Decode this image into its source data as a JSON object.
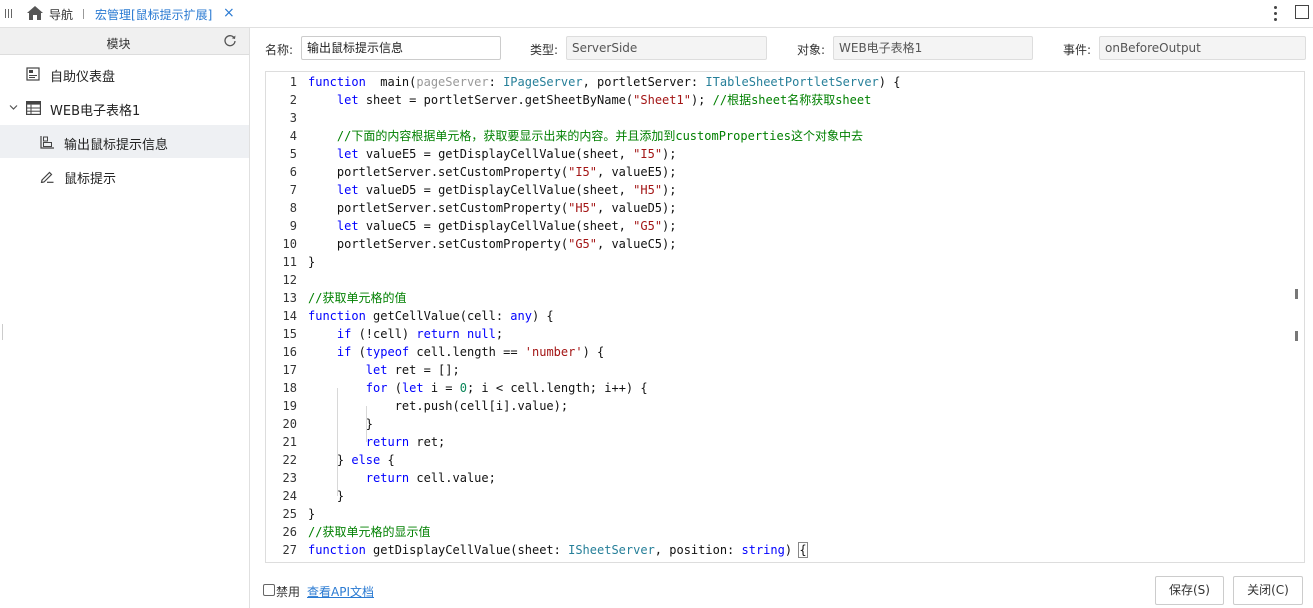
{
  "topbar": {
    "nav_label": "导航",
    "tab_label": "宏管理[鼠标提示扩展]",
    "close_glyph": "×"
  },
  "sidebar": {
    "header": "模块",
    "items": [
      {
        "label": "自助仪表盘",
        "icon": "dashboard-icon"
      },
      {
        "label": "WEB电子表格1",
        "icon": "spreadsheet-icon",
        "expanded": true
      },
      {
        "label": "输出鼠标提示信息",
        "icon": "macro-icon",
        "active": true
      },
      {
        "label": "鼠标提示",
        "icon": "pen-icon"
      }
    ]
  },
  "form": {
    "name_label": "名称:",
    "name_value": "输出鼠标提示信息",
    "type_label": "类型:",
    "type_value": "ServerSide",
    "object_label": "对象:",
    "object_value": "WEB电子表格1",
    "event_label": "事件:",
    "event_value": "onBeforeOutput"
  },
  "editor": {
    "line_numbers": [
      "1",
      "2",
      "3",
      "4",
      "5",
      "6",
      "7",
      "8",
      "9",
      "10",
      "11",
      "12",
      "13",
      "14",
      "15",
      "16",
      "17",
      "18",
      "19",
      "20",
      "21",
      "22",
      "23",
      "24",
      "25",
      "26",
      "27"
    ],
    "lines": [
      [
        [
          "kw",
          "function"
        ],
        [
          "",
          "  main("
        ],
        [
          "pm",
          "pageServer"
        ],
        [
          "",
          ": "
        ],
        [
          "ty",
          "IPageServer"
        ],
        [
          "",
          ", portletServer: "
        ],
        [
          "ty",
          "ITableSheetPortletServer"
        ],
        [
          "",
          ") {"
        ]
      ],
      [
        [
          "",
          "    "
        ],
        [
          "kw",
          "let"
        ],
        [
          "",
          " sheet = portletServer.getSheetByName("
        ],
        [
          "st",
          "\"Sheet1\""
        ],
        [
          "",
          "); "
        ],
        [
          "cm",
          "//根据sheet名称获取sheet"
        ]
      ],
      [],
      [
        [
          "",
          "    "
        ],
        [
          "cm",
          "//下面的内容根据单元格，获取要显示出来的内容。并且添加到customProperties这个对象中去"
        ]
      ],
      [
        [
          "",
          "    "
        ],
        [
          "kw",
          "let"
        ],
        [
          "",
          " valueE5 = getDisplayCellValue(sheet, "
        ],
        [
          "st",
          "\"I5\""
        ],
        [
          "",
          ");"
        ]
      ],
      [
        [
          "",
          "    portletServer.setCustomProperty("
        ],
        [
          "st",
          "\"I5\""
        ],
        [
          "",
          ", valueE5);"
        ]
      ],
      [
        [
          "",
          "    "
        ],
        [
          "kw",
          "let"
        ],
        [
          "",
          " valueD5 = getDisplayCellValue(sheet, "
        ],
        [
          "st",
          "\"H5\""
        ],
        [
          "",
          ");"
        ]
      ],
      [
        [
          "",
          "    portletServer.setCustomProperty("
        ],
        [
          "st",
          "\"H5\""
        ],
        [
          "",
          ", valueD5);"
        ]
      ],
      [
        [
          "",
          "    "
        ],
        [
          "kw",
          "let"
        ],
        [
          "",
          " valueC5 = getDisplayCellValue(sheet, "
        ],
        [
          "st",
          "\"G5\""
        ],
        [
          "",
          ");"
        ]
      ],
      [
        [
          "",
          "    portletServer.setCustomProperty("
        ],
        [
          "st",
          "\"G5\""
        ],
        [
          "",
          ", valueC5);"
        ]
      ],
      [
        [
          "",
          "}"
        ]
      ],
      [],
      [
        [
          "cm",
          "//获取单元格的值"
        ]
      ],
      [
        [
          "kw",
          "function"
        ],
        [
          "",
          " getCellValue(cell: "
        ],
        [
          "kw",
          "any"
        ],
        [
          "",
          ") {"
        ]
      ],
      [
        [
          "",
          "    "
        ],
        [
          "kw",
          "if"
        ],
        [
          "",
          " (!cell) "
        ],
        [
          "kw",
          "return"
        ],
        [
          "",
          " "
        ],
        [
          "kw",
          "null"
        ],
        [
          "",
          ";"
        ]
      ],
      [
        [
          "",
          "    "
        ],
        [
          "kw",
          "if"
        ],
        [
          "",
          " ("
        ],
        [
          "kw",
          "typeof"
        ],
        [
          "",
          " cell.length == "
        ],
        [
          "st",
          "'number'"
        ],
        [
          "",
          ") {"
        ]
      ],
      [
        [
          "",
          "        "
        ],
        [
          "kw",
          "let"
        ],
        [
          "",
          " ret = [];"
        ]
      ],
      [
        [
          "",
          "        "
        ],
        [
          "kw",
          "for"
        ],
        [
          "",
          " ("
        ],
        [
          "kw",
          "let"
        ],
        [
          "",
          " i = "
        ],
        [
          "nm",
          "0"
        ],
        [
          "",
          "; i < cell.length; i++) {"
        ]
      ],
      [
        [
          "",
          "            ret.push(cell[i].value);"
        ]
      ],
      [
        [
          "",
          "        }"
        ]
      ],
      [
        [
          "",
          "        "
        ],
        [
          "kw",
          "return"
        ],
        [
          "",
          " ret;"
        ]
      ],
      [
        [
          "",
          "    } "
        ],
        [
          "kw",
          "else"
        ],
        [
          "",
          " {"
        ]
      ],
      [
        [
          "",
          "        "
        ],
        [
          "kw",
          "return"
        ],
        [
          "",
          " cell.value;"
        ]
      ],
      [
        [
          "",
          "    }"
        ]
      ],
      [
        [
          "",
          "}"
        ]
      ],
      [
        [
          "cm",
          "//获取单元格的显示值"
        ]
      ],
      [
        [
          "kw",
          "function"
        ],
        [
          "",
          " getDisplayCellValue(sheet: "
        ],
        [
          "ty",
          "ISheetServer"
        ],
        [
          "",
          ", position: "
        ],
        [
          "kw",
          "string"
        ],
        [
          "",
          ") "
        ],
        [
          "cur",
          "{"
        ]
      ]
    ]
  },
  "bottom": {
    "disable_label": "禁用",
    "api_link": "查看API文档",
    "save_label": "保存(S)",
    "close_label": "关闭(C)"
  }
}
